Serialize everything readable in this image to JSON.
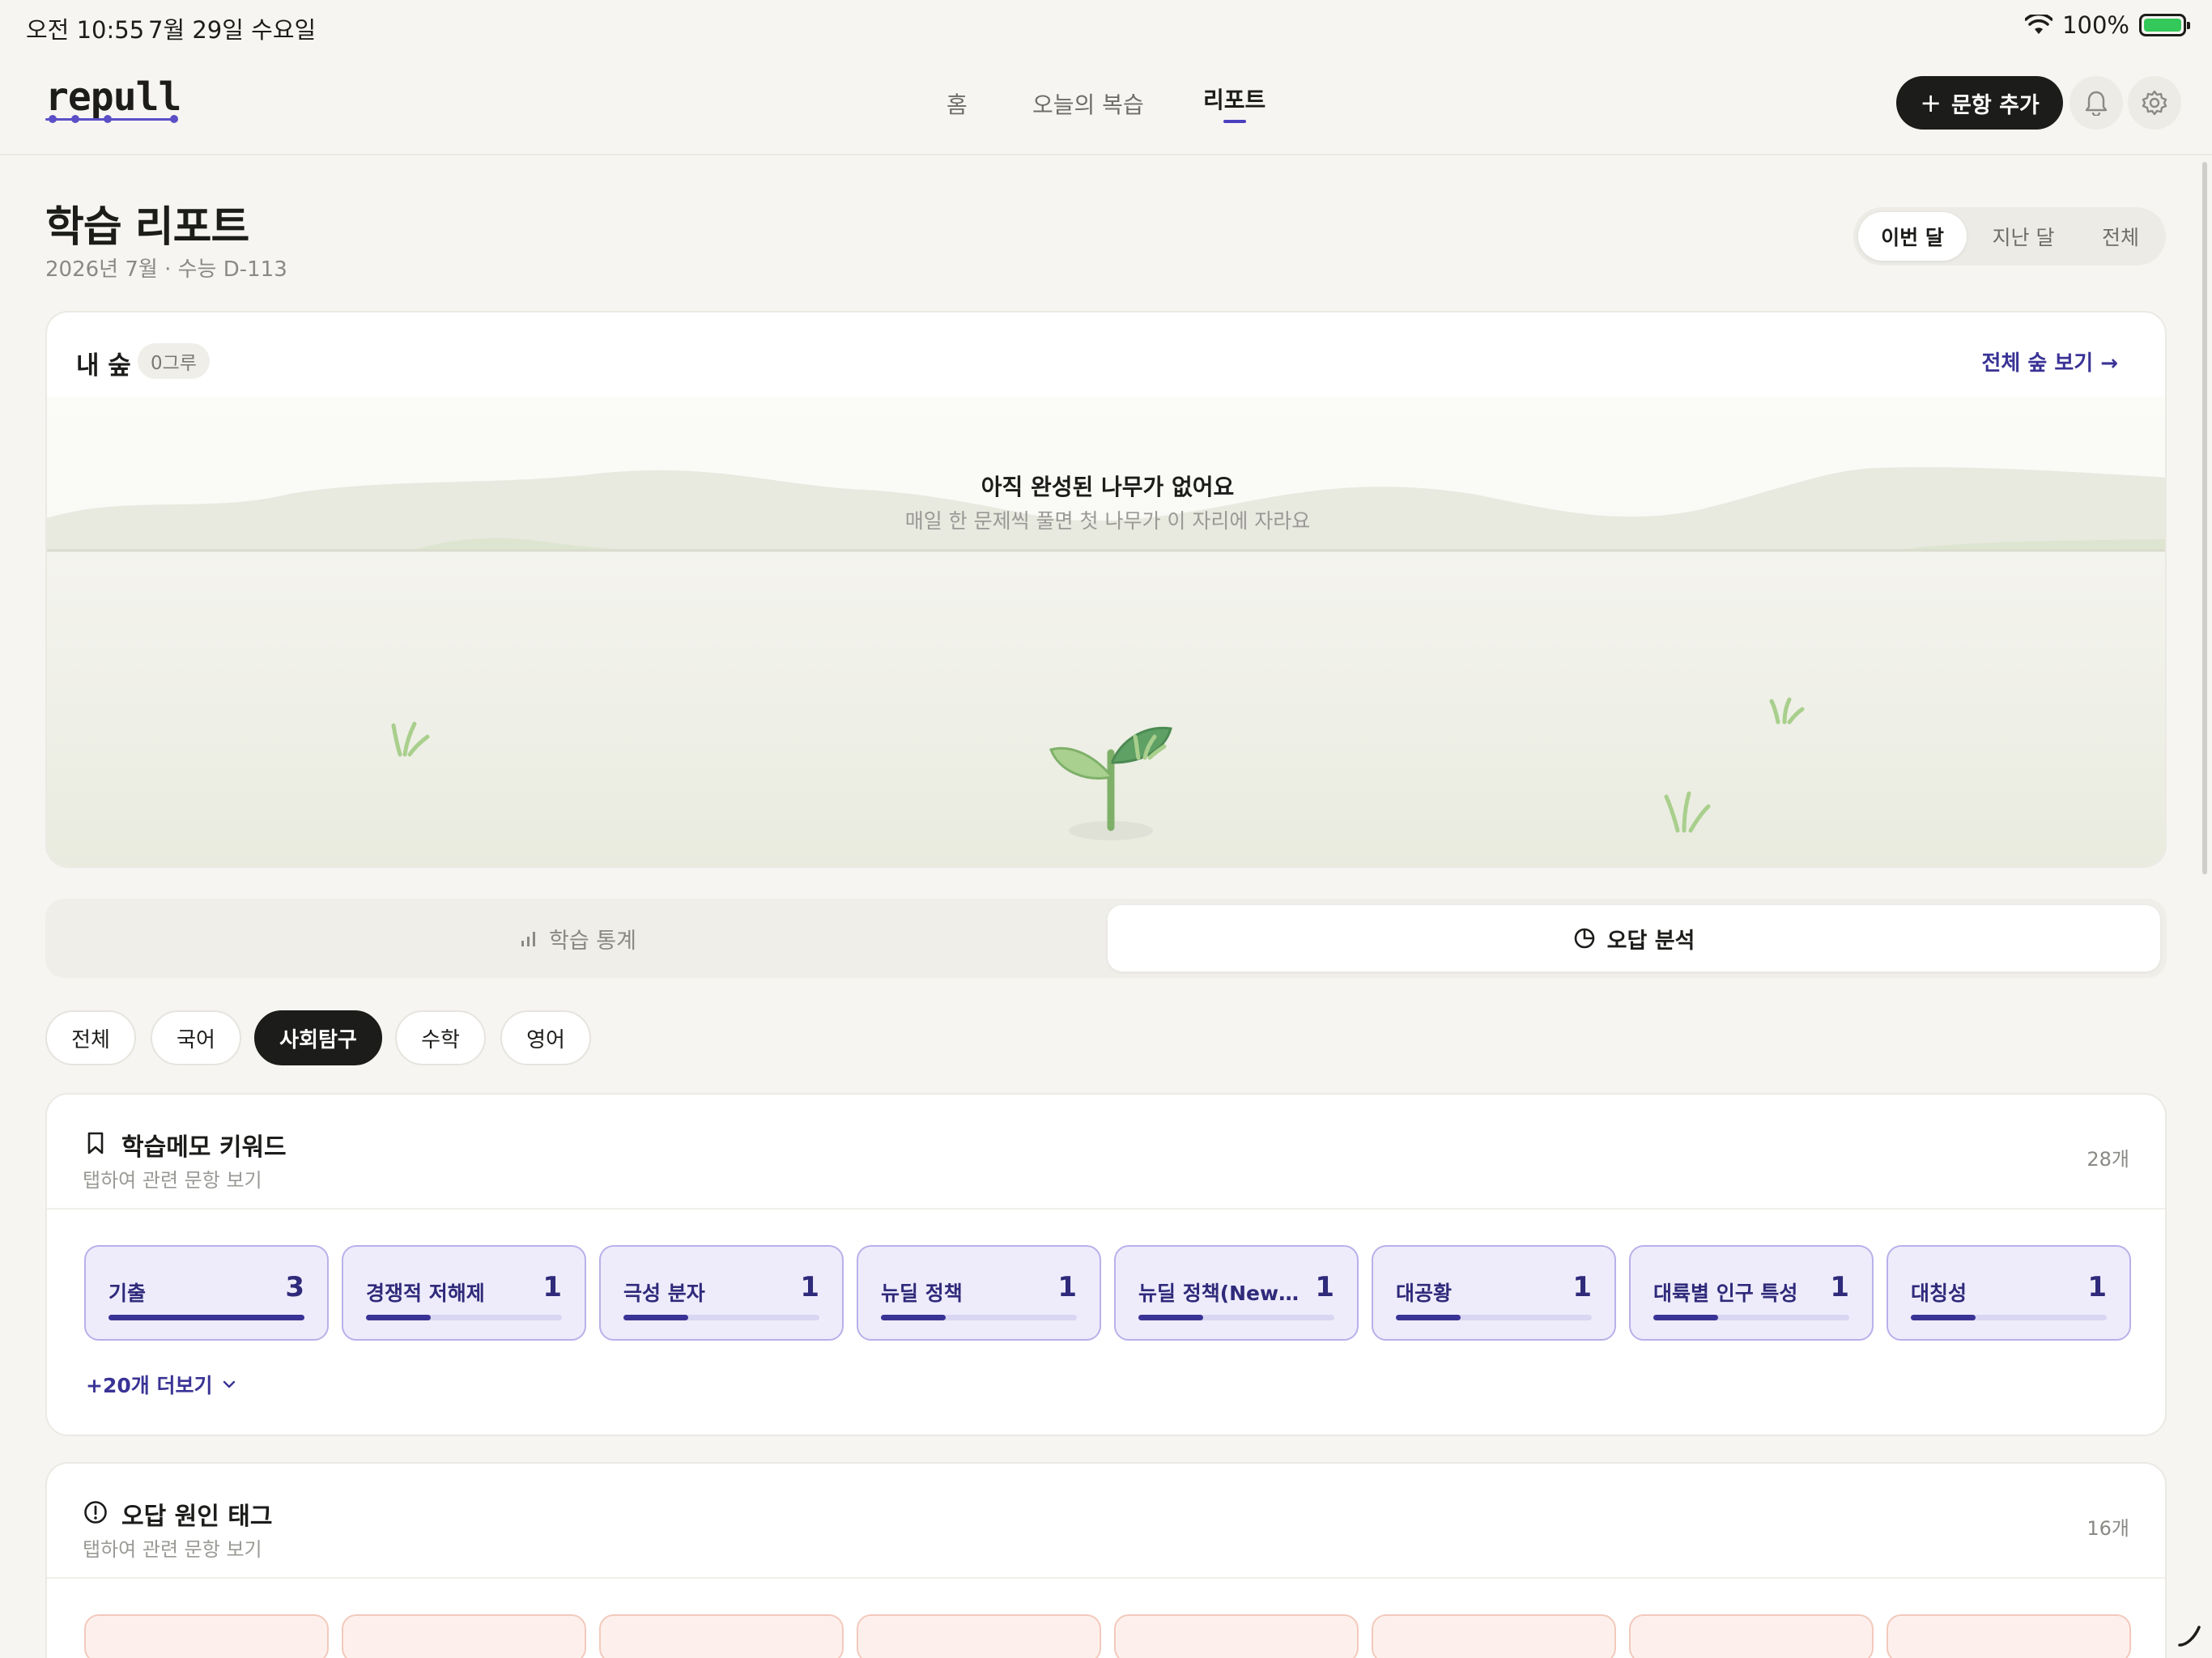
{
  "status_bar": {
    "time": "오전 10:55",
    "date": "7월 29일 수요일",
    "battery": "100%"
  },
  "header": {
    "logo": "repull",
    "nav": [
      "홈",
      "오늘의 복습",
      "리포트"
    ],
    "add_button": "문항 추가"
  },
  "page": {
    "title": "학습 리포트",
    "subtitle": "2026년 7월 · 수능 D-113",
    "period_options": [
      "이번 달",
      "지난 달",
      "전체"
    ]
  },
  "forest": {
    "title": "내 숲",
    "badge": "0그루",
    "link": "전체 숲 보기 →",
    "empty_title": "아직 완성된 나무가 없어요",
    "empty_sub": "매일 한 문제씩 풀면 첫 나무가 이 자리에 자라요"
  },
  "tabs": [
    "학습 통계",
    "오답 분석"
  ],
  "subjects": [
    "전체",
    "국어",
    "사회탐구",
    "수학",
    "영어"
  ],
  "keywords": {
    "title": "학습메모 키워드",
    "sub": "탭하여 관련 문항 보기",
    "count": "28개",
    "items": [
      {
        "label": "기출",
        "count": "3",
        "ratio": 1.0
      },
      {
        "label": "경쟁적 저해제",
        "count": "1",
        "ratio": 0.33
      },
      {
        "label": "극성 분자",
        "count": "1",
        "ratio": 0.33
      },
      {
        "label": "뉴딜 정책",
        "count": "1",
        "ratio": 0.33
      },
      {
        "label": "뉴딜 정책(New D...",
        "count": "1",
        "ratio": 0.33
      },
      {
        "label": "대공황",
        "count": "1",
        "ratio": 0.33
      },
      {
        "label": "대륙별 인구 특성",
        "count": "1",
        "ratio": 0.33
      },
      {
        "label": "대칭성",
        "count": "1",
        "ratio": 0.33
      }
    ],
    "more": "+20개 더보기"
  },
  "error_tags": {
    "title": "오답 원인 태그",
    "sub": "탭하여 관련 문항 보기",
    "count": "16개"
  },
  "colors": {
    "accent": "#4b3fc0",
    "dark": "#1c1c1a",
    "keyword_bg": "#eeecfb",
    "tag_bg": "#fdf0ec"
  }
}
